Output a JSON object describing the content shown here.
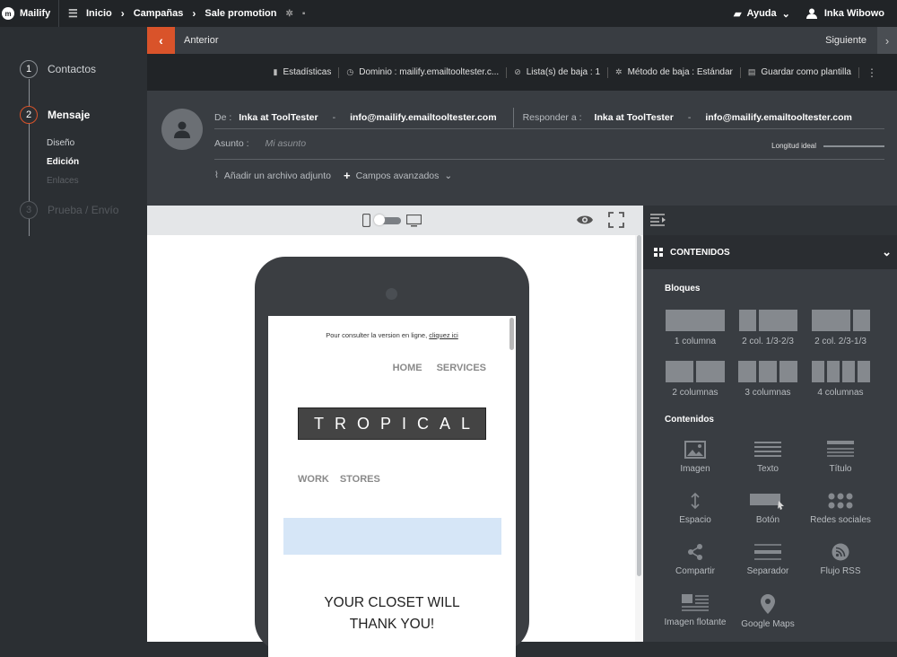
{
  "topbar": {
    "logo": "Mailify",
    "crumbs": [
      "Inicio",
      "Campañas",
      "Sale promotion"
    ],
    "help": "Ayuda",
    "user": "Inka Wibowo"
  },
  "steps": {
    "s1_num": "1",
    "s1": "Contactos",
    "s2_num": "2",
    "s2": "Mensaje",
    "sub_design": "Diseño",
    "sub_edit": "Edición",
    "sub_links": "Enlaces",
    "s3_num": "3",
    "s3": "Prueba / Envío"
  },
  "nav": {
    "prev": "Anterior",
    "next": "Siguiente"
  },
  "tools": {
    "stats": "Estadísticas",
    "domain": "Dominio : mailify.emailtooltester.c...",
    "unsub_list": "Lista(s) de baja : 1",
    "unsub_method": "Método de baja : Estándar",
    "save_template": "Guardar como plantilla"
  },
  "header": {
    "from_label": "De :",
    "from_name": "Inka at ToolTester",
    "from_email": "info@mailify.emailtooltester.com",
    "reply_label": "Responder a :",
    "reply_name": "Inka at ToolTester",
    "reply_email": "info@mailify.emailtooltester.com",
    "subject_label": "Asunto :",
    "subject_placeholder": "Mi asunto",
    "ideal_length": "Longitud ideal",
    "attach": "Añadir un archivo adjunto",
    "advanced": "Campos avanzados"
  },
  "email": {
    "online_text": "Pour consulter la version en ligne, ",
    "online_link": "cliquez ici",
    "nav1": [
      "HOME",
      "SERVICES"
    ],
    "brand": "TROPICAL",
    "nav2": [
      "WORK",
      "STORES"
    ],
    "closet_line1": "YOUR CLOSET WILL",
    "closet_line2": "THANK YOU!"
  },
  "panel": {
    "title": "CONTENIDOS",
    "blocks_title": "Bloques",
    "blocks": [
      "1 columna",
      "2 col. 1/3-2/3",
      "2 col. 2/3-1/3",
      "2 columnas",
      "3 columnas",
      "4 columnas"
    ],
    "contents_title": "Contenidos",
    "contents": [
      "Imagen",
      "Texto",
      "Título",
      "Espacio",
      "Botón",
      "Redes sociales",
      "Compartir",
      "Separador",
      "Flujo RSS",
      "Imagen flotante",
      "Google Maps"
    ]
  }
}
